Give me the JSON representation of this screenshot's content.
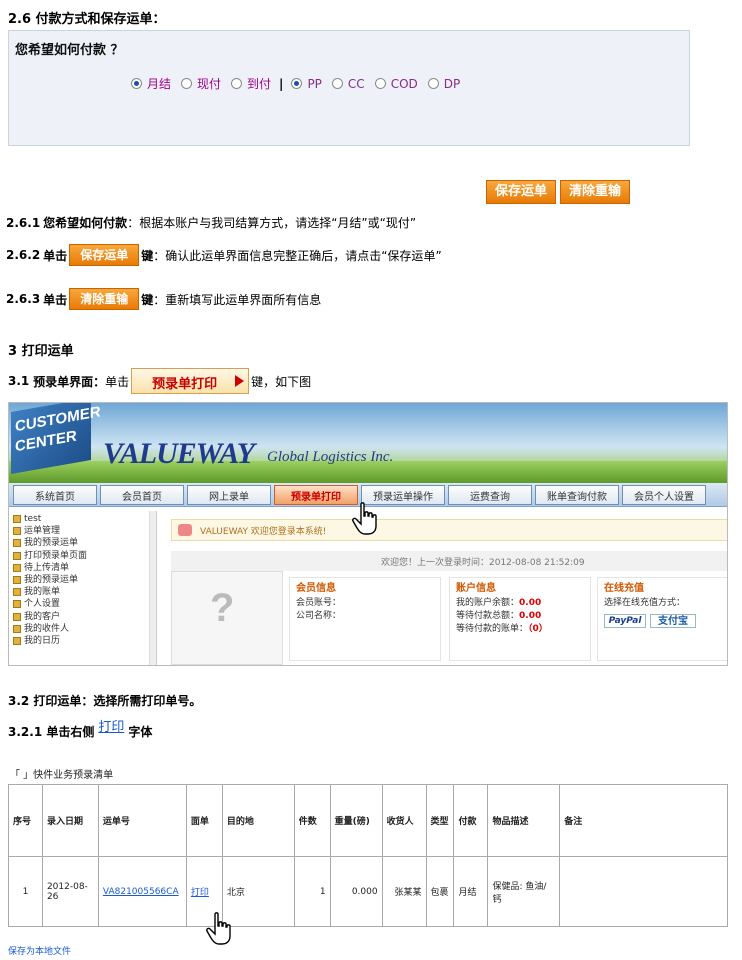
{
  "section_2_6": {
    "title": "2.6 付款方式和保存运单：",
    "question": "您希望如何付款 ？",
    "settlement_options": [
      "月结",
      "现付",
      "到付"
    ],
    "settlement_selected": 0,
    "separator": "|",
    "freight_options": [
      "PP",
      "CC",
      "COD",
      "DP"
    ],
    "freight_selected": 0,
    "save_button": "保存运单",
    "clear_button": "清除重输"
  },
  "steps": {
    "s261_num": "2.6.1",
    "s261_bold": "您希望如何付款",
    "s261_text": "：根据本账户与我司结算方式，请选择“月结”或“现付”",
    "s262_num": "2.6.2",
    "s262_bold": "单击",
    "s262_btn": "保存运单",
    "s262_key": "键",
    "s262_text": "：确认此运单界面信息完整正确后，请点击“保存运单”",
    "s263_num": "2.6.3",
    "s263_bold": "单击",
    "s263_btn": "清除重输",
    "s263_key": "键",
    "s263_text": "：重新填写此运单界面所有信息"
  },
  "section_3": {
    "title": "3   打印运单",
    "s31_num": "3.1",
    "s31_bold": "预录单界面：",
    "s31_text": "单击",
    "s31_btn": "预录单打印",
    "s31_tail": "键，如下图"
  },
  "site": {
    "badge": "CUSTOMER CENTER",
    "logo": "VALUEWAY",
    "logo_sub": "Global Logistics Inc.",
    "nav": [
      "系统首页",
      "会员首页",
      "网上录单",
      "预录单打印",
      "预录运单操作",
      "运费查询",
      "账单查询付款",
      "会员个人设置"
    ],
    "nav_active": 3,
    "tree": [
      "test",
      "运单管理",
      "我的预录运单",
      "打印预录单页面",
      "待上传清单",
      "我的预录运单",
      "我的账单",
      "个人设置",
      "我的客户",
      "我的收件人",
      "我的日历"
    ],
    "welcome": "VALUEWAY 欢迎您登录本系统!",
    "last_login": "欢迎您！上一次登录时间：2012-08-08 21:52:09",
    "member": {
      "title": "会员信息",
      "line1": "会员账号：",
      "line2": "公司名称："
    },
    "account": {
      "title": "账户信息",
      "line1": "我的账户余额：",
      "v1": "0.00",
      "line2": "等待付款总额：",
      "v2": "0.00",
      "line3": "等待付款的账单：",
      "v3": "（0）"
    },
    "pay": {
      "title": "在线充值",
      "line1": "选择在线充值方式：",
      "paypal": "PayPal",
      "alipay": "支付宝"
    }
  },
  "section_3_2": {
    "title": "3.2 打印运单：选择所需打印单号。",
    "s321_pre": "3.2.1 单击右侧",
    "s321_link": "打印",
    "s321_post": "字体",
    "list_title": "「      」快件业务预录清单",
    "table": {
      "headers": [
        "序号",
        "录入日期",
        "运单号",
        "面单",
        "目的地",
        "件数",
        "重量(磅)",
        "收货人",
        "类型",
        "付款",
        "物品描述",
        "备注"
      ],
      "rows": [
        [
          "1",
          "2012-08-26",
          "VA821005566CA",
          "打印",
          "北京",
          "1",
          "0.000",
          "张某某",
          "包裹",
          "月结",
          "保健品: 鱼油/钙",
          ""
        ]
      ]
    },
    "save_local": "保存为本地文件"
  }
}
